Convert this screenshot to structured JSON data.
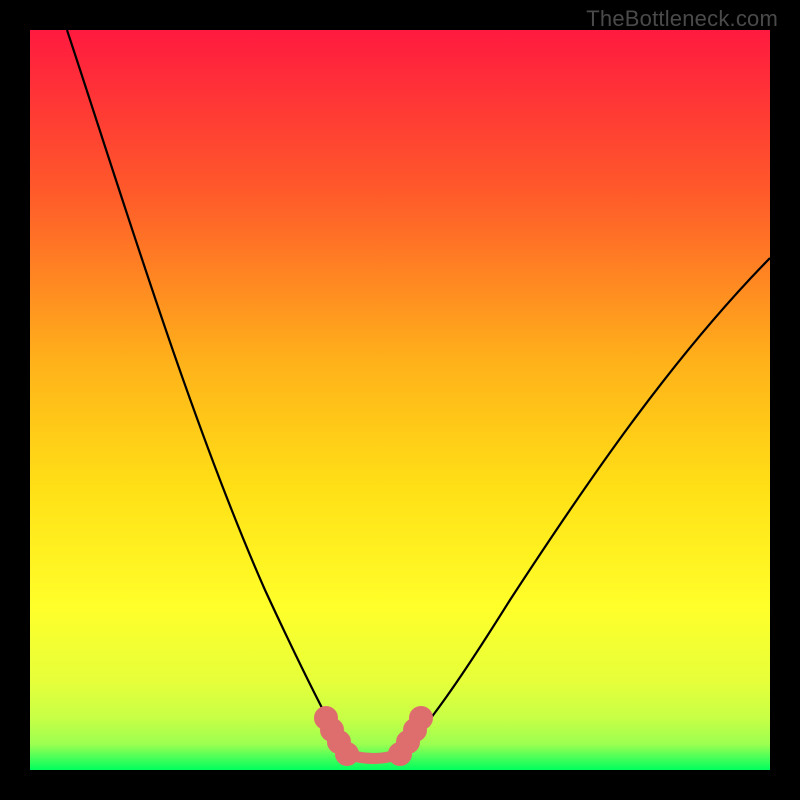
{
  "watermark": "TheBottleneck.com",
  "chart_data": {
    "type": "line",
    "title": "",
    "xlabel": "",
    "ylabel": "",
    "xlim": [
      0,
      100
    ],
    "ylim": [
      0,
      100
    ],
    "grid": false,
    "gradient_colors": {
      "top": "#ff1a3f",
      "mid_upper": "#ff7a1f",
      "mid": "#ffe016",
      "mid_lower": "#d7ff2f",
      "lower_jump": "#8fff4f",
      "bottom": "#00ff5e"
    },
    "series": [
      {
        "name": "curve-left",
        "x": [
          5,
          10,
          15,
          20,
          25,
          30,
          35,
          38,
          40,
          42
        ],
        "y": [
          100,
          85,
          70,
          56,
          42,
          29,
          16,
          8,
          3,
          0
        ],
        "color": "#000000"
      },
      {
        "name": "curve-right",
        "x": [
          50,
          52,
          55,
          60,
          65,
          70,
          75,
          80,
          85,
          90,
          95,
          100
        ],
        "y": [
          0,
          2,
          6,
          12,
          19,
          26,
          33,
          41,
          49,
          57,
          64,
          69
        ],
        "color": "#000000"
      },
      {
        "name": "highlight-left",
        "x": [
          40,
          41,
          42,
          43
        ],
        "y": [
          6,
          4,
          2,
          1
        ],
        "color": "#e06a6a"
      },
      {
        "name": "highlight-bottom",
        "x": [
          43,
          45,
          47,
          49
        ],
        "y": [
          1,
          0.5,
          0.5,
          1
        ],
        "color": "#e06a6a"
      },
      {
        "name": "highlight-right",
        "x": [
          49,
          50,
          51,
          52
        ],
        "y": [
          1,
          2,
          4,
          6
        ],
        "color": "#e06a6a"
      }
    ]
  }
}
